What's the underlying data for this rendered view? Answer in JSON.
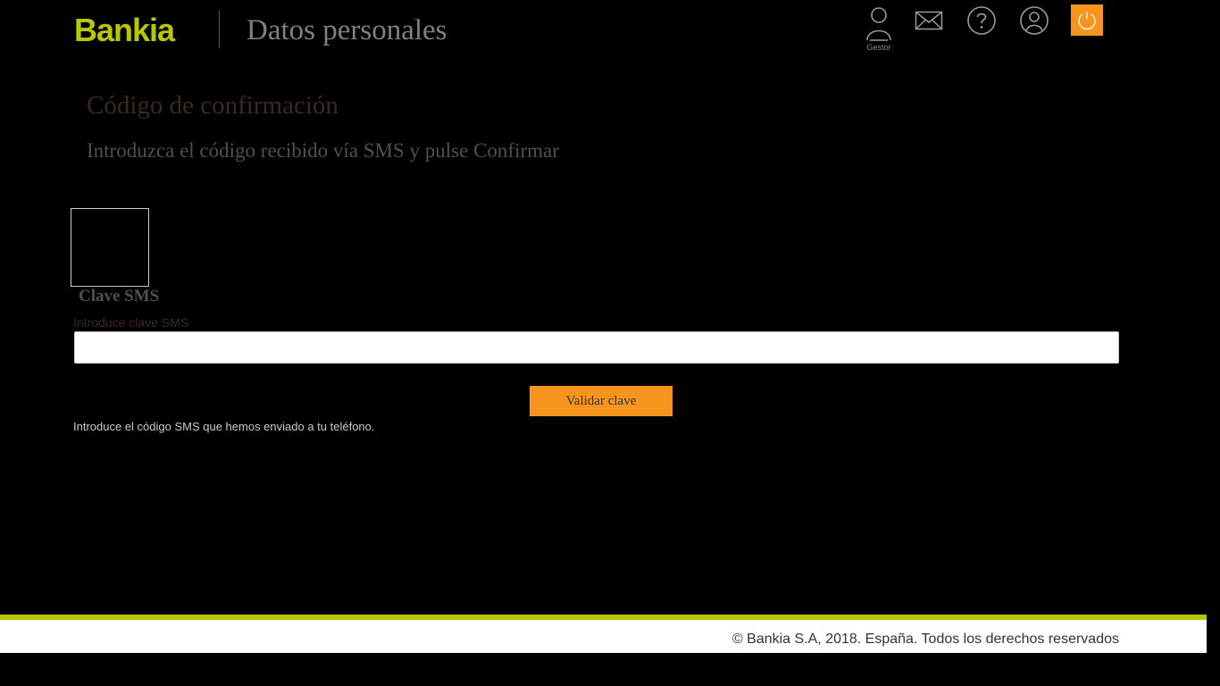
{
  "header": {
    "logo_text": "Bankia",
    "title": "Datos personales",
    "icons": {
      "gestor": {
        "icon": "user-manager-icon",
        "label": "Gestor"
      },
      "mail": {
        "icon": "envelope-icon"
      },
      "help": {
        "icon": "question-circle-icon"
      },
      "profile": {
        "icon": "user-circle-icon"
      },
      "logout": {
        "icon": "power-icon"
      }
    }
  },
  "main": {
    "title": "Código de confirmación",
    "subtitle": "Introduzca el código recibido vía SMS y pulse Confirmar",
    "field_title": "Clave SMS",
    "field_label": "Introduce clave SMS",
    "input_value": "",
    "input_placeholder": "",
    "button_label": "Validar clave",
    "help_text": "Introduce el código SMS que hemos enviado a tu teléfono."
  },
  "footer": {
    "copyright": "© Bankia S.A, 2018. España. Todos los derechos reservados"
  },
  "colors": {
    "brand_green": "#b7c800",
    "accent_orange": "#f7941d",
    "background": "#000000"
  }
}
